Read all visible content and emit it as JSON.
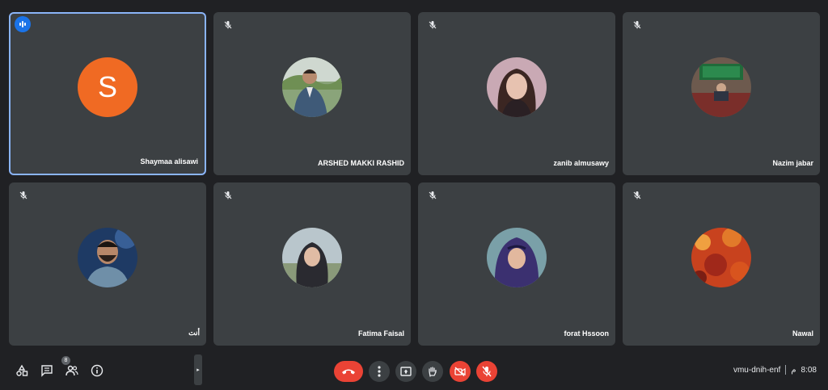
{
  "participants": [
    {
      "name": "Shaymaa alisawi",
      "initial": "S",
      "avatar_color": "#f06a23",
      "speaking": true
    },
    {
      "name": "ARSHED MAKKI RASHID"
    },
    {
      "name": "zanib almusawy"
    },
    {
      "name": "Nazim jabar"
    },
    {
      "name": "أنت"
    },
    {
      "name": "Fatima Faisal"
    },
    {
      "name": "forat Hssoon"
    },
    {
      "name": "Nawal"
    }
  ],
  "toolbar": {
    "people_count": "8",
    "meeting_code": "vmu-dnih-enf",
    "time": "8:08",
    "time_suffix": "م"
  },
  "colors": {
    "background": "#202124",
    "tile": "#3c4043",
    "active_border": "#8ab4f8",
    "danger": "#ea4335"
  },
  "icons": [
    "mic-off-icon",
    "speaking-icon",
    "activities-icon",
    "chat-icon",
    "people-icon",
    "info-icon",
    "end-call-icon",
    "more-options-icon",
    "present-icon",
    "raise-hand-icon",
    "camera-off-icon"
  ]
}
